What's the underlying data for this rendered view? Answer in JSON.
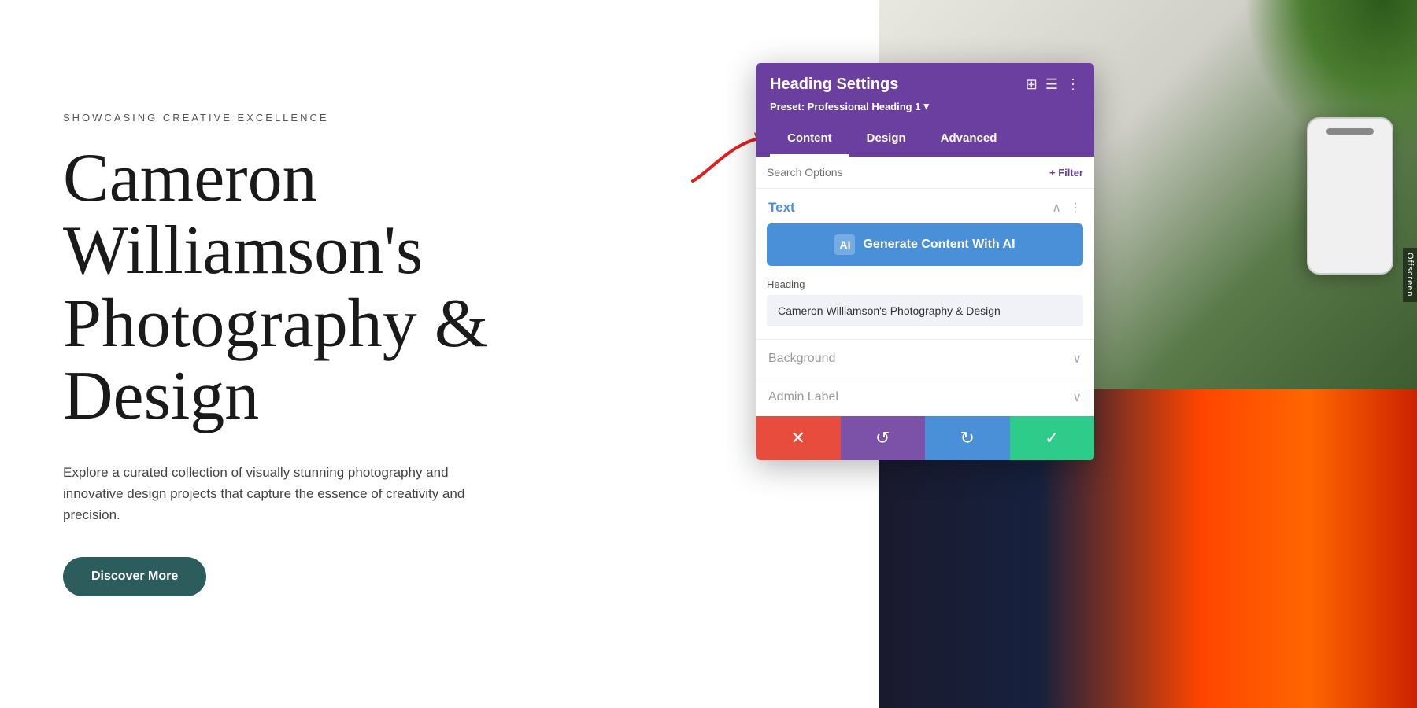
{
  "page": {
    "subtitle": "SHOWCASING CREATIVE EXCELLENCE",
    "heading_line1": "Cameron",
    "heading_line2": "Williamson's",
    "heading_line3": "Photography &",
    "heading_line4": "Design",
    "description": "Explore a curated collection of visually stunning photography and innovative design projects that capture the essence of creativity and precision.",
    "cta_button": "Discover More",
    "offscreen_label": "Offscreen"
  },
  "panel": {
    "title": "Heading Settings",
    "preset_label": "Preset: Professional Heading 1",
    "preset_chevron": "▾",
    "tabs": [
      {
        "id": "content",
        "label": "Content",
        "active": true
      },
      {
        "id": "design",
        "label": "Design",
        "active": false
      },
      {
        "id": "advanced",
        "label": "Advanced",
        "active": false
      }
    ],
    "search_placeholder": "Search Options",
    "filter_label": "+ Filter",
    "text_section_title": "Text",
    "ai_button_label": "Generate Content With AI",
    "ai_icon_label": "AI",
    "heading_field_label": "Heading",
    "heading_field_value": "Cameron Williamson's Photography & Design",
    "background_section_title": "Background",
    "admin_label_section_title": "Admin Label",
    "footer": {
      "cancel_icon": "✕",
      "undo_icon": "↺",
      "redo_icon": "↻",
      "save_icon": "✓"
    }
  },
  "colors": {
    "panel_header_bg": "#6b3fa0",
    "tab_active_underline": "#ffffff",
    "ai_button_bg": "#4a90d9",
    "section_title_color": "#4a90d9",
    "cancel_btn": "#e74c3c",
    "undo_btn": "#7b52a8",
    "redo_btn": "#4a90d9",
    "save_btn": "#2ecc8a",
    "discover_btn": "#2d5c5c"
  }
}
